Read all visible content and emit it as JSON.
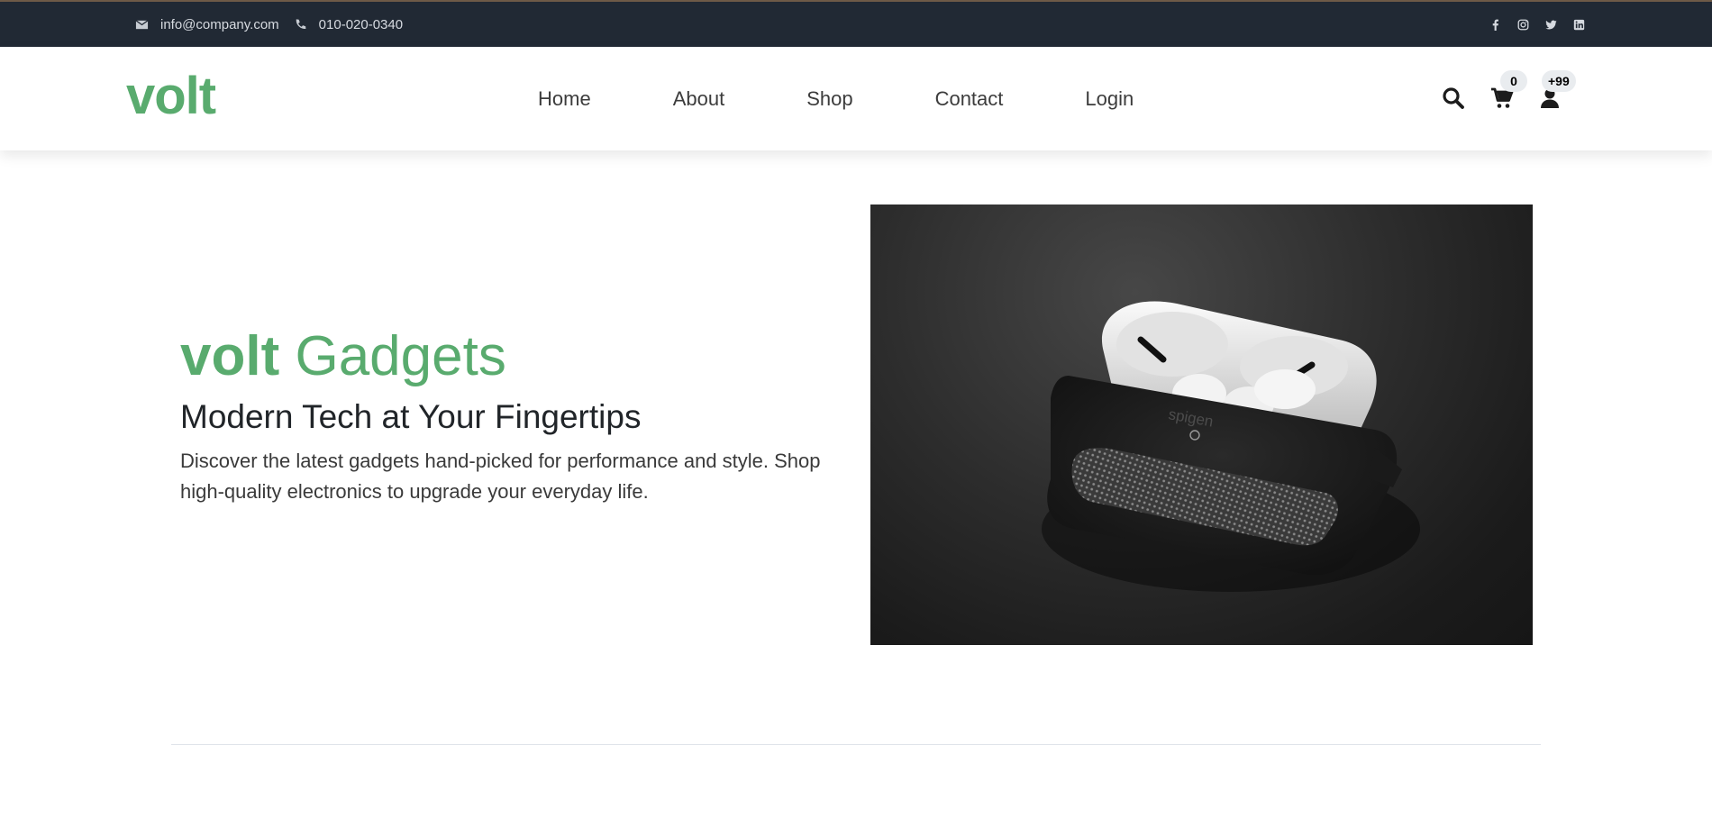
{
  "topbar": {
    "email": "info@company.com",
    "phone": "010-020-0340",
    "social": [
      "facebook-icon",
      "instagram-icon",
      "twitter-icon",
      "linkedin-icon"
    ]
  },
  "header": {
    "brand": "volt",
    "nav": [
      "Home",
      "About",
      "Shop",
      "Contact",
      "Login"
    ],
    "cart_count": "0",
    "user_count": "+99",
    "icons": [
      "search-icon",
      "cart-icon",
      "user-icon"
    ]
  },
  "hero": {
    "title_bold": "volt",
    "title_light": "Gadgets",
    "subtitle": "Modern Tech at Your Fingertips",
    "description": "Discover the latest gadgets hand-picked for performance and style. Shop high-quality electronics to upgrade your everyday life.",
    "image_text": "spigen"
  },
  "colors": {
    "brand": "#59ab6e",
    "topbar": "#212934",
    "text": "#212529"
  }
}
